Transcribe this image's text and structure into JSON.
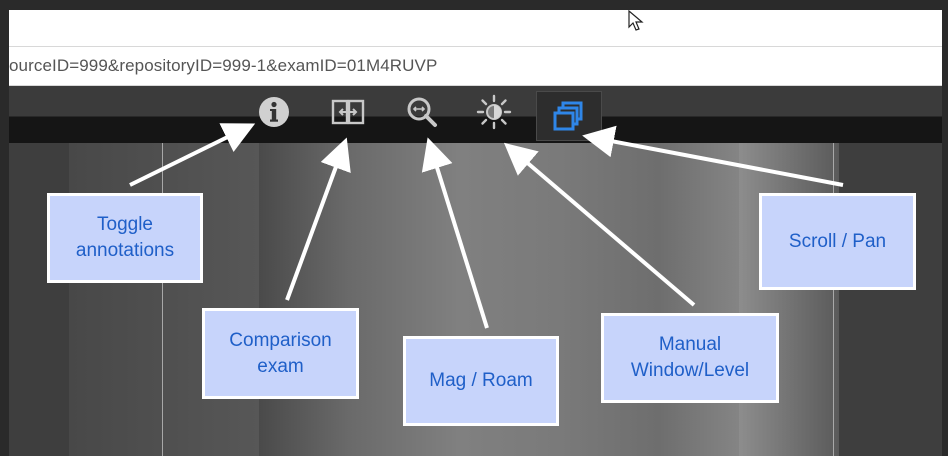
{
  "browser": {
    "url": "ourceID=999&repositoryID=999-1&examID=01M4RUVP"
  },
  "toolbar": {
    "buttons": [
      {
        "icon": "info-icon",
        "active": false
      },
      {
        "icon": "comparison-icon",
        "active": false
      },
      {
        "icon": "magnify-icon",
        "active": false
      },
      {
        "icon": "brightness-icon",
        "active": false
      },
      {
        "icon": "stacked-windows-icon",
        "active": true
      }
    ]
  },
  "callouts": {
    "toggle_annotations": "Toggle annotations",
    "comparison_exam": "Comparison exam",
    "mag_roam": "Mag / Roam",
    "manual_window_level": "Manual Window/Level",
    "scroll_pan": "Scroll / Pan"
  },
  "colors": {
    "callout_bg": "#c7d4fb",
    "callout_text": "#1f5fc8",
    "active_icon": "#2f86e8"
  }
}
